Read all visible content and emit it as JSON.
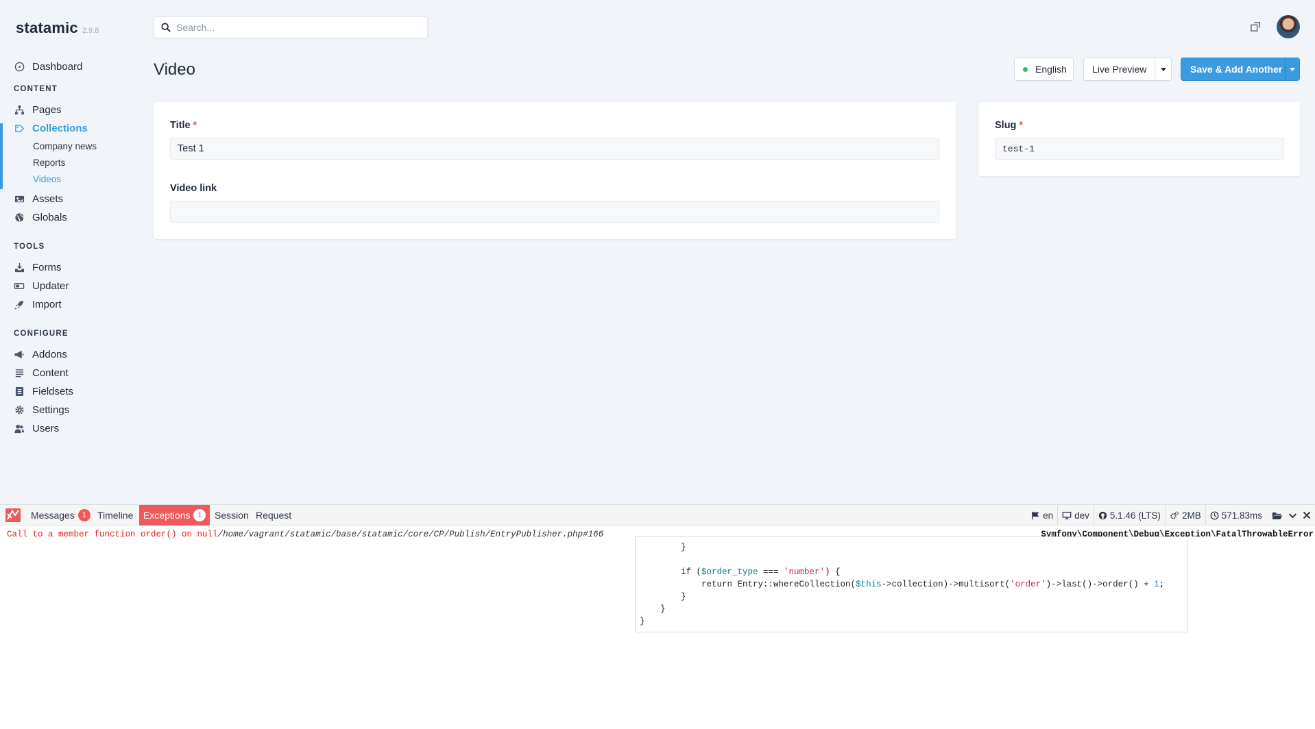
{
  "app": {
    "brand": "statamic",
    "version": "2.9.8"
  },
  "search": {
    "placeholder": "Search..."
  },
  "nav": {
    "dashboard": "Dashboard",
    "content_heading": "CONTENT",
    "pages": "Pages",
    "collections": "Collections",
    "collection_items": [
      "Company news",
      "Reports",
      "Videos"
    ],
    "assets": "Assets",
    "globals": "Globals",
    "tools_heading": "TOOLS",
    "forms": "Forms",
    "updater": "Updater",
    "import": "Import",
    "configure_heading": "CONFIGURE",
    "addons": "Addons",
    "content": "Content",
    "fieldsets": "Fieldsets",
    "settings": "Settings",
    "users": "Users"
  },
  "page": {
    "title": "Video"
  },
  "toolbar": {
    "language": "English",
    "live_preview": "Live Preview",
    "save": "Save & Add Another"
  },
  "form": {
    "title_label": "Title",
    "title_value": "Test 1",
    "video_label": "Video link",
    "video_value": "",
    "slug_label": "Slug",
    "slug_value": "test-1",
    "required_mark": "*"
  },
  "debugbar": {
    "tabs": {
      "messages": "Messages",
      "messages_count": "1",
      "timeline": "Timeline",
      "exceptions": "Exceptions",
      "exceptions_count": "1",
      "session": "Session",
      "request": "Request"
    },
    "stats": {
      "locale": "en",
      "env": "dev",
      "version": "5.1.46 (LTS)",
      "memory": "2MB",
      "time": "571.83ms"
    },
    "exception": {
      "message": "Call to a member function order() on null",
      "path": "/home/vagrant/statamic/base/statamic/core/CP/Publish/EntryPublisher.php#166",
      "class": "Symfony\\Component\\Debug\\Exception\\FatalThrowableError"
    },
    "code": {
      "l1": "        }",
      "l2": "",
      "l3_a": "        if (",
      "l3_var": "$order_type",
      "l3_b": " === ",
      "l3_str": "'number'",
      "l3_c": ") {",
      "l4_a": "            return Entry::whereCollection(",
      "l4_var": "$this",
      "l4_b": "->collection)->multisort(",
      "l4_str": "'order'",
      "l4_c": ")->last()->order() + ",
      "l4_num": "1",
      "l4_d": ";",
      "l5": "        }",
      "l6": "    }",
      "l7": "}"
    }
  },
  "colors": {
    "accent": "#3b9be0",
    "danger": "#f1585c",
    "success": "#3fb36b"
  },
  "icons": [
    "search-icon",
    "dashboard-icon",
    "pages-icon",
    "collections-icon",
    "assets-icon",
    "globals-icon",
    "forms-icon",
    "updater-icon",
    "import-icon",
    "addons-icon",
    "content-icon",
    "fieldsets-icon",
    "settings-icon",
    "users-icon",
    "external-link-icon",
    "flag-icon",
    "desktop-icon",
    "github-icon",
    "cogs-icon",
    "clock-icon",
    "folder-icon",
    "chevron-down-icon",
    "close-icon"
  ]
}
